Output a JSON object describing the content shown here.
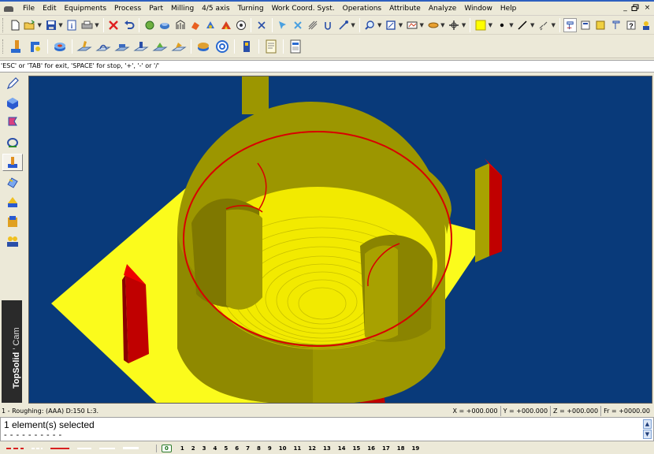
{
  "menu": {
    "items": [
      "File",
      "Edit",
      "Equipments",
      "Process",
      "Part",
      "Milling",
      "4/5 axis",
      "Turning",
      "Work Coord. Syst.",
      "Operations",
      "Attribute",
      "Analyze",
      "Window",
      "Help"
    ],
    "window_controls": [
      "_",
      "ř",
      "×"
    ]
  },
  "prompt": {
    "text": "'ESC' or 'TAB' for exit, 'SPACE' for stop, '+', '-' or '/'"
  },
  "palette": {
    "brand_bold": "TopSolid",
    "brand_light": " ’ Cam"
  },
  "status": {
    "operation": "1 - Roughing:   (AAA)  D:150  L:3.",
    "x": "X = +000.000",
    "y": "Y = +000.000",
    "z": "Z = +000.000",
    "fr": "Fr = +0000.00"
  },
  "message": {
    "text": "1 element(s) selected",
    "dashes": "- - - - - - - - - -"
  },
  "layers": {
    "current": "0",
    "items": [
      "1",
      "2",
      "3",
      "4",
      "5",
      "6",
      "7",
      "8",
      "9",
      "10",
      "11",
      "12",
      "13",
      "14",
      "15",
      "16",
      "17",
      "18",
      "19"
    ]
  },
  "colors": {
    "viewport_bg": "#093a7a",
    "part_yellow": "#fbfb1c",
    "wall_olive": "#9c9600",
    "edge_red": "#d80000",
    "pin_red": "#c00000",
    "current_layer_green": "#167016"
  },
  "icons": {
    "toolbar_row1": [
      "new-icon",
      "open-icon",
      "save-icon",
      "info-icon",
      "print-icon",
      "delete-icon",
      "undo-icon",
      "view-icons",
      "zoom-icon",
      "fit-icon",
      "color-icon",
      "point-icon",
      "line-icon",
      "hatch-icon"
    ],
    "toolbar_row2": [
      "mill-icons",
      "simulate-icon",
      "target-icon",
      "tool-icon",
      "document-icon"
    ],
    "palette": [
      "pencil-icon",
      "cube-icon",
      "flag-icon",
      "machine-icon",
      "turning-icon",
      "tool-icon",
      "assembly-icon",
      "document-icon",
      "people-icon"
    ]
  }
}
